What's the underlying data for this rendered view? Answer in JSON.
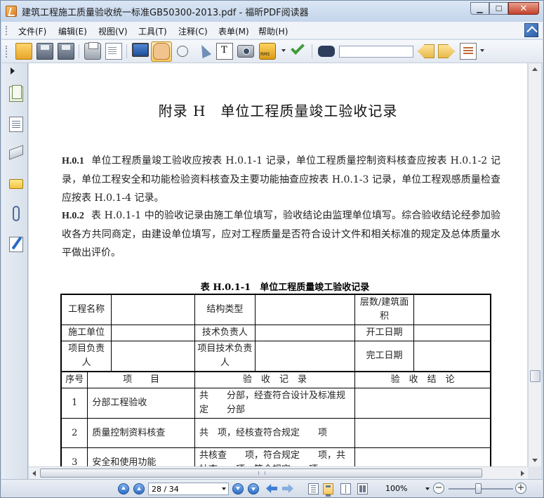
{
  "window": {
    "title": "建筑工程施工质量验收统一标准GB50300-2013.pdf - 福昕PDF阅读器",
    "min_label": "▁",
    "max_label": "☐",
    "close_label": "✕"
  },
  "menu": {
    "items": [
      {
        "label": "文件(F)"
      },
      {
        "label": "编辑(E)"
      },
      {
        "label": "视图(V)"
      },
      {
        "label": "工具(T)"
      },
      {
        "label": "注释(C)"
      },
      {
        "label": "表单(M)"
      },
      {
        "label": "帮助(H)"
      }
    ]
  },
  "toolbar": {
    "icons": [
      "open-folder-icon",
      "save-icon",
      "save-all-icon",
      "print-icon",
      "properties-icon",
      "fullscreen-monitor-icon",
      "hand-tool-icon",
      "zoom-select-icon",
      "select-arrow-icon",
      "text-select-icon",
      "snapshot-camera-icon",
      "rms-lock-icon",
      "sign-check-icon",
      "find-binoculars-icon",
      "find-previous-icon",
      "find-next-icon",
      "document-list-icon"
    ],
    "search": {
      "value": "",
      "placeholder": ""
    }
  },
  "sidebar": {
    "icons": [
      "pages-panel-icon",
      "bookmarks-panel-icon",
      "layers-panel-icon",
      "comments-panel-icon",
      "attachments-clip-icon",
      "signatures-panel-icon"
    ]
  },
  "document": {
    "heading": "附录 H　单位工程质量竣工验收记录",
    "paragraphs": [
      {
        "num": "H.0.1",
        "text": "单位工程质量竣工验收应按表 H.0.1-1 记录，单位工程质量控制资料核查应按表 H.0.1-2 记录，单位工程安全和功能检验资料核查及主要功能抽查应按表 H.0.1-3 记录，单位工程观感质量检查应按表 H.0.1-4 记录。"
      },
      {
        "num": "H.0.2",
        "text": "表 H.0.1-1 中的验收记录由施工单位填写，验收结论由监理单位填写。综合验收结论经参加验收各方共同商定，由建设单位填写，应对工程质量是否符合设计文件和相关标准的规定及总体质量水平做出评价。"
      }
    ],
    "table_caption": "表 H.0.1-1　单位工程质量竣工验收记录",
    "table": {
      "project_name": "工程名称",
      "structure_type": "结构类型",
      "floors_area": "层数/建筑面积",
      "construction_unit": "施工单位",
      "tech_leader": "技术负责人",
      "start_date": "开工日期",
      "project_leader": "项目负责人",
      "project_tech_leader": "项目技术负责人",
      "completion_date": "完工日期",
      "col_no": "序号",
      "col_item": "项　　目",
      "col_record": "验　收　记　录",
      "col_conclusion": "验　收　结　论",
      "rows": [
        {
          "no": "1",
          "item": "分部工程验收",
          "record": "共　　分部，经查符合设计及标准规定　　分部"
        },
        {
          "no": "2",
          "item": "质量控制资料核查",
          "record": "共　项，经核查符合规定　　项"
        },
        {
          "no": "3",
          "item": "安全和使用功能",
          "record": "共核查　　项，符合规定　　项，共抽查　　项，符合规定　　项"
        }
      ]
    }
  },
  "statusbar": {
    "page_value": "28 / 34",
    "zoom_value": "100%",
    "zoom_slider_fraction": 0.45,
    "zoom_out_label": "−",
    "zoom_in_label": "+"
  }
}
